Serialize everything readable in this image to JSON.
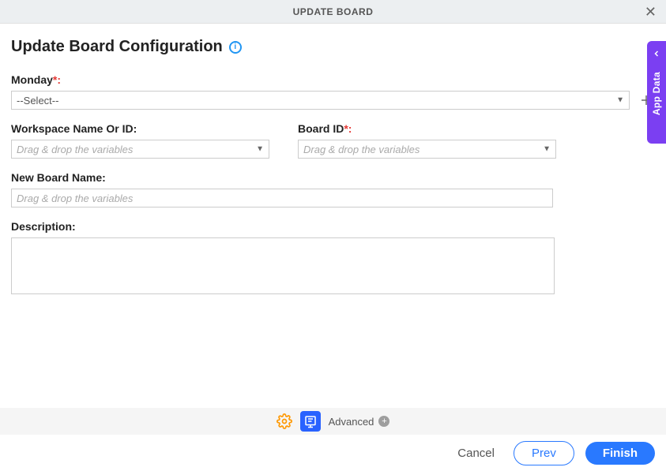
{
  "header": {
    "title": "UPDATE BOARD"
  },
  "page": {
    "title": "Update Board Configuration"
  },
  "fields": {
    "monday": {
      "label": "Monday",
      "required_suffix": "*:",
      "value": "--Select--"
    },
    "workspace": {
      "label": "Workspace Name Or ID:",
      "placeholder": "Drag & drop the variables"
    },
    "board_id": {
      "label": "Board ID",
      "required_suffix": "*:",
      "placeholder": "Drag & drop the variables"
    },
    "new_board_name": {
      "label": "New Board Name:",
      "placeholder": "Drag & drop the variables"
    },
    "description": {
      "label": "Description:"
    }
  },
  "sidebar": {
    "app_data_label": "App Data"
  },
  "toolbar": {
    "advanced_label": "Advanced"
  },
  "footer": {
    "cancel": "Cancel",
    "prev": "Prev",
    "finish": "Finish"
  }
}
